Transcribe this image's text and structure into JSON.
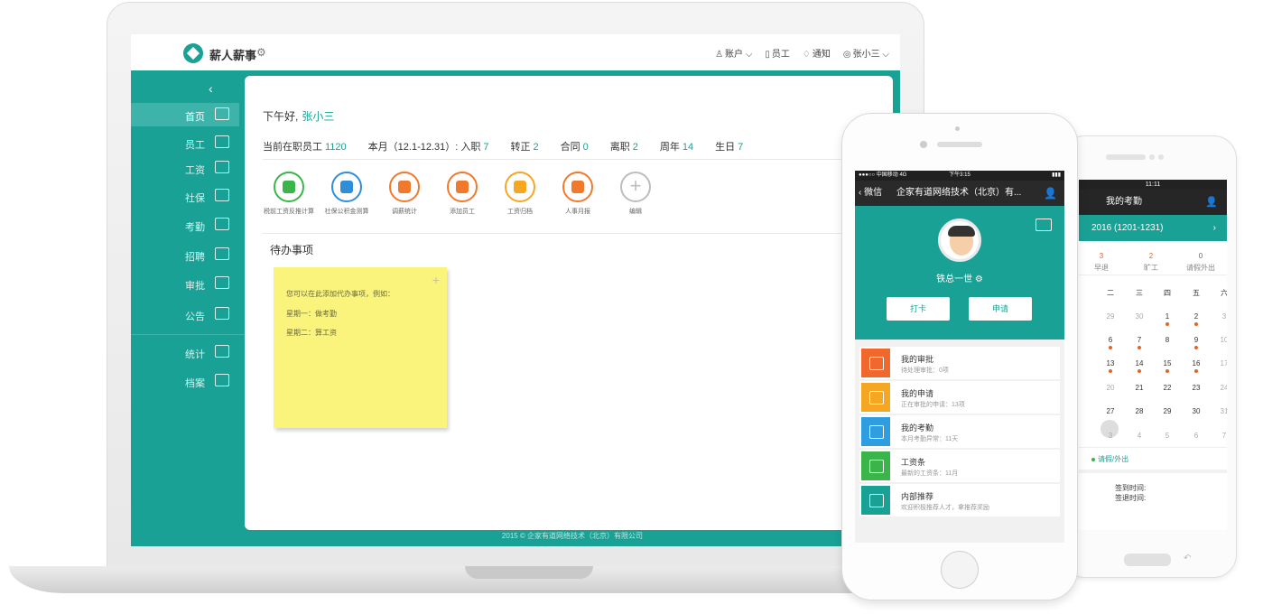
{
  "app": {
    "brand": "薪人薪事",
    "nav": [
      "账户",
      "员工",
      "通知",
      "张小三"
    ],
    "sidebar": [
      "首页",
      "员工",
      "工资",
      "社保",
      "考勤",
      "招聘",
      "审批",
      "公告",
      "统计",
      "档案"
    ],
    "greeting_prefix": "下午好,",
    "greeting_name": "张小三",
    "stats": [
      {
        "label": "当前在职员工",
        "value": "1120"
      },
      {
        "label": "本月（12.1-12.31）: 入职",
        "value": "7"
      },
      {
        "label": "转正",
        "value": "2"
      },
      {
        "label": "合同",
        "value": "0"
      },
      {
        "label": "离职",
        "value": "2"
      },
      {
        "label": "周年",
        "value": "14"
      },
      {
        "label": "生日",
        "value": "7"
      }
    ],
    "quick_actions": [
      {
        "label": "税前工资反推计算",
        "color": "#3ab54a"
      },
      {
        "label": "社保公积金测算",
        "color": "#2f8ed8"
      },
      {
        "label": "调薪统计",
        "color": "#f07a2c"
      },
      {
        "label": "添加员工",
        "color": "#f07a2c"
      },
      {
        "label": "工资归档",
        "color": "#f5a623"
      },
      {
        "label": "人事月报",
        "color": "#f07a2c"
      },
      {
        "label": "编辑",
        "color": "#bdbdbd"
      }
    ],
    "todo_title": "待办事项",
    "sticky_lines": [
      "您可以在此添加代办事项，例如：",
      "星期一：做考勤",
      "星期二：算工资"
    ],
    "footer": "2015 © 企家有道网络技术（北京）有限公司"
  },
  "phone_front": {
    "status": [
      "●●●○○ 中国移动 4G",
      "下午3:15",
      "▮▮▮"
    ],
    "back": "微信",
    "title": "企家有道网络技术（北京）有...",
    "user_name": "铁总一世 ⚙",
    "btn_punch": "打卡",
    "btn_apply": "申请",
    "rows": [
      {
        "title": "我的审批",
        "sub": "待处理审批：0项",
        "color": "#f0682c"
      },
      {
        "title": "我的申请",
        "sub": "正在审批的申请：13项",
        "color": "#f5a623"
      },
      {
        "title": "我的考勤",
        "sub": "本月考勤异常：11天",
        "color": "#2f9ee0"
      },
      {
        "title": "工资条",
        "sub": "最新的工资条：11月",
        "color": "#3ab54a"
      },
      {
        "title": "内部推荐",
        "sub": "欢迎积极推荐人才，拿推荐奖励",
        "color": "#1aa196"
      }
    ]
  },
  "phone_back": {
    "time": "11:11",
    "title": "我的考勤",
    "range": "2016 (1201-1231)",
    "summary": [
      {
        "n": "3",
        "l": "早退"
      },
      {
        "n": "2",
        "l": "旷工"
      },
      {
        "n": "0",
        "l": "请假外出"
      }
    ],
    "weekdays": [
      "二",
      "三",
      "四",
      "五",
      "六"
    ],
    "weeks": [
      [
        "29",
        "30",
        "1",
        "2",
        "3"
      ],
      [
        "6",
        "7",
        "8",
        "9",
        "10"
      ],
      [
        "13",
        "14",
        "15",
        "16",
        "17"
      ],
      [
        "20",
        "21",
        "22",
        "23",
        "24"
      ],
      [
        "27",
        "28",
        "29",
        "30",
        "31"
      ],
      [
        "3",
        "4",
        "5",
        "6",
        "7"
      ]
    ],
    "legend": "请假/外出",
    "sign_in": "签到时间:",
    "sign_out": "签退时间:"
  }
}
